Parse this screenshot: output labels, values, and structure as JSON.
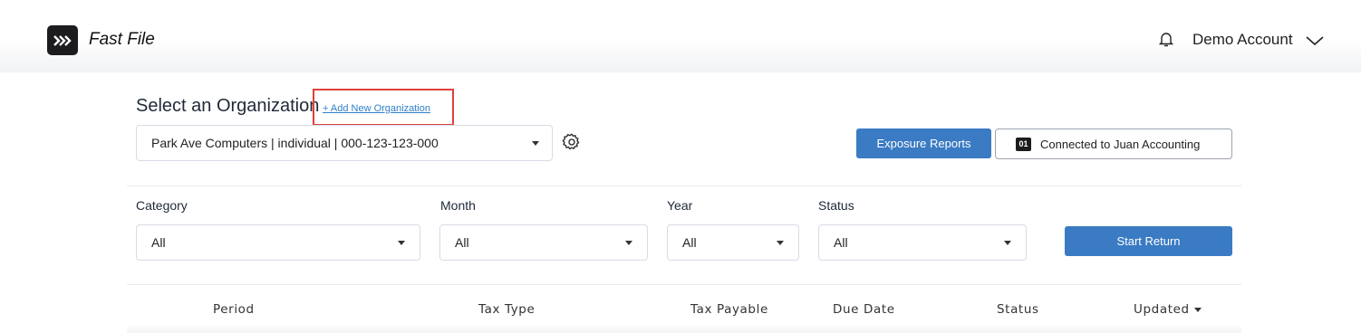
{
  "header": {
    "app_title": "Fast File",
    "account_name": "Demo Account",
    "icons": {
      "logo": "chevrons-right-icon",
      "notifications": "bell-icon",
      "account_menu": "chevron-down-icon"
    }
  },
  "organization": {
    "heading": "Select an Organization",
    "add_link": "+ Add New Organization",
    "selected": "Park Ave Computers | individual | 000-123-123-000",
    "settings_icon": "gear-icon"
  },
  "actions": {
    "exposure_reports": "Exposure Reports",
    "connection_badge": "01",
    "connection_label": "Connected to Juan Accounting",
    "start_return": "Start Return"
  },
  "filters": {
    "category": {
      "label": "Category",
      "value": "All"
    },
    "month": {
      "label": "Month",
      "value": "All"
    },
    "year": {
      "label": "Year",
      "value": "All"
    },
    "status": {
      "label": "Status",
      "value": "All"
    }
  },
  "table": {
    "columns": [
      "Period",
      "Tax Type",
      "Tax Payable",
      "Due Date",
      "Status",
      "Updated"
    ],
    "sorted_column": "Updated"
  },
  "colors": {
    "primary": "#3a7bc3",
    "highlight": "#e0403a",
    "link": "#2f80c9",
    "logo_bg": "#1c1c1e"
  }
}
